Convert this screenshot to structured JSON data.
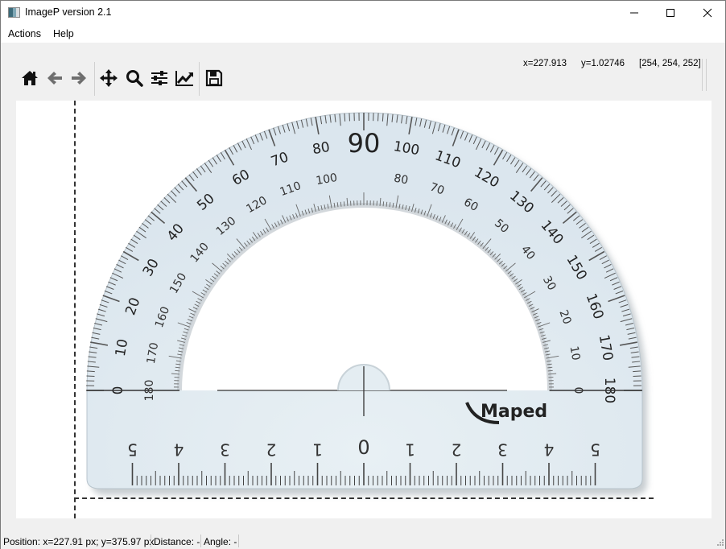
{
  "window": {
    "title": "ImageP version 2.1",
    "controls": {
      "minimize": "minimize",
      "maximize": "maximize",
      "close": "close"
    }
  },
  "menu": {
    "items": [
      {
        "label": "Actions"
      },
      {
        "label": "Help"
      }
    ]
  },
  "toolbar": {
    "buttons": [
      {
        "name": "home",
        "icon": "home-icon"
      },
      {
        "name": "back",
        "icon": "arrow-left-icon"
      },
      {
        "name": "forward",
        "icon": "arrow-right-icon"
      },
      {
        "name": "pan",
        "icon": "move-icon"
      },
      {
        "name": "zoom",
        "icon": "magnifier-icon"
      },
      {
        "name": "configure-subplots",
        "icon": "sliders-icon"
      },
      {
        "name": "edit-axis",
        "icon": "line-chart-icon"
      },
      {
        "name": "save",
        "icon": "floppy-disk-icon"
      }
    ],
    "readout": {
      "x": "x=227.913",
      "y": "y=1.02746",
      "rgb": "[254, 254, 252]"
    }
  },
  "image": {
    "subject": "Maped protractor",
    "brand": "Maped",
    "outer_scale_labels": [
      "0",
      "10",
      "20",
      "30",
      "40",
      "50",
      "60",
      "70",
      "80",
      "90",
      "100",
      "110",
      "120",
      "130",
      "140",
      "150",
      "160",
      "170",
      "180"
    ],
    "inner_scale_labels": [
      "180",
      "170",
      "160",
      "150",
      "140",
      "130",
      "120",
      "110",
      "100",
      "80",
      "70",
      "60",
      "50",
      "40",
      "30",
      "20",
      "10",
      "0"
    ],
    "ruler_labels": [
      "5",
      "4",
      "3",
      "2",
      "1",
      "0",
      "1",
      "2",
      "3",
      "4",
      "5"
    ]
  },
  "statusbar": {
    "position": "Position: x=227.91 px; y=375.97 px",
    "distance": "Distance: -",
    "angle": "Angle: -"
  }
}
